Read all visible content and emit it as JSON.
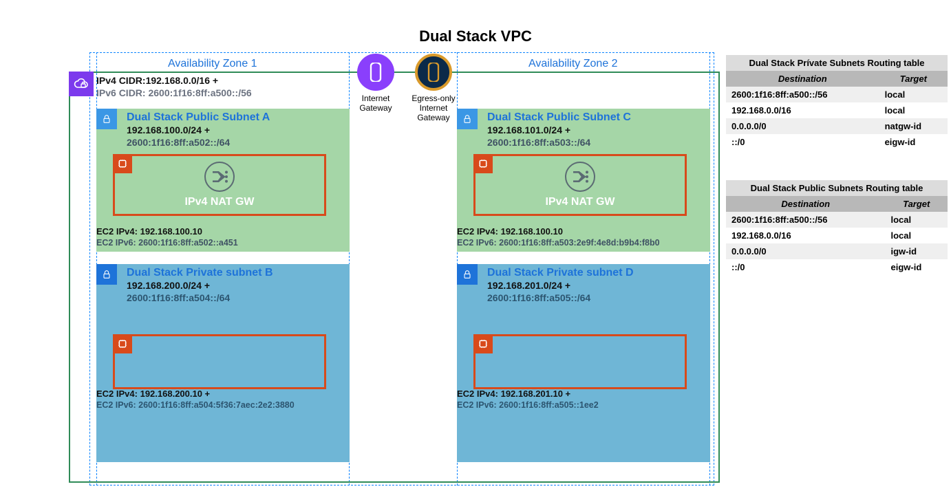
{
  "title": "Dual Stack VPC",
  "az1_label": "Availability Zone 1",
  "az2_label": "Availability Zone 2",
  "vpc": {
    "ipv4_label": "IPv4 CIDR:192.168.0.0/16 +",
    "ipv6_label": "IPv6 CIDR: 2600:1f16:8ff:a500::/56",
    "icon": "cloud-lock-icon"
  },
  "gateways": {
    "igw": {
      "label1": "Internet",
      "label2": "Gateway",
      "icon": "internet-gateway-icon"
    },
    "eigw": {
      "label1": "Egress-only",
      "label2": "Internet",
      "label3": "Gateway",
      "icon": "egress-only-internet-gateway-icon"
    }
  },
  "subnets": {
    "a": {
      "name": "Dual Stack Public Subnet A",
      "cidr4": "192.168.100.0/24 +",
      "cidr6": "2600:1f16:8ff:a502::/64",
      "natgw_label": "IPv4 NAT GW",
      "ec2_ipv4": "EC2 IPv4: 192.168.100.10",
      "ec2_ipv6": "EC2 IPv6: 2600:1f16:8ff:a502::a451"
    },
    "c": {
      "name": "Dual Stack Public Subnet C",
      "cidr4": "192.168.101.0/24 +",
      "cidr6": "2600:1f16:8ff:a503::/64",
      "natgw_label": "IPv4 NAT GW",
      "ec2_ipv4": "EC2 IPv4: 192.168.100.10",
      "ec2_ipv6": "EC2 IPv6: 2600:1f16:8ff:a503:2e9f:4e8d:b9b4:f8b0"
    },
    "b": {
      "name": "Dual Stack Private subnet B",
      "cidr4": "192.168.200.0/24 +",
      "cidr6": "2600:1f16:8ff:a504::/64",
      "ec2_ipv4": "EC2 IPv4: 192.168.200.10 +",
      "ec2_ipv6": "EC2 IPv6: 2600:1f16:8ff:a504:5f36:7aec:2e2:3880"
    },
    "d": {
      "name": "Dual Stack Private subnet D",
      "cidr4": "192.168.201.0/24 +",
      "cidr6": "2600:1f16:8ff:a505::/64",
      "ec2_ipv4": "EC2 IPv4: 192.168.201.10 +",
      "ec2_ipv6": "EC2 IPv6: 2600:1f16:8ff:a505::1ee2"
    }
  },
  "routing": {
    "private": {
      "title": "Dual Stack Prívate Subnets Routing table",
      "col1": "Destination",
      "col2": "Target",
      "rows": [
        {
          "dest": "2600:1f16:8ff:a500::/56",
          "target": "local"
        },
        {
          "dest": "192.168.0.0/16",
          "target": "local"
        },
        {
          "dest": "0.0.0.0/0",
          "target": "natgw-id"
        },
        {
          "dest": "::/0",
          "target": "eigw-id"
        }
      ]
    },
    "public": {
      "title": "Dual Stack Public Subnets Routing table",
      "col1": "Destination",
      "col2": "Target",
      "rows": [
        {
          "dest": "2600:1f16:8ff:a500::/56",
          "target": "local"
        },
        {
          "dest": "192.168.0.0/16",
          "target": "local"
        },
        {
          "dest": "0.0.0.0/0",
          "target": "igw-id"
        },
        {
          "dest": "::/0",
          "target": "eigw-id"
        }
      ]
    }
  }
}
